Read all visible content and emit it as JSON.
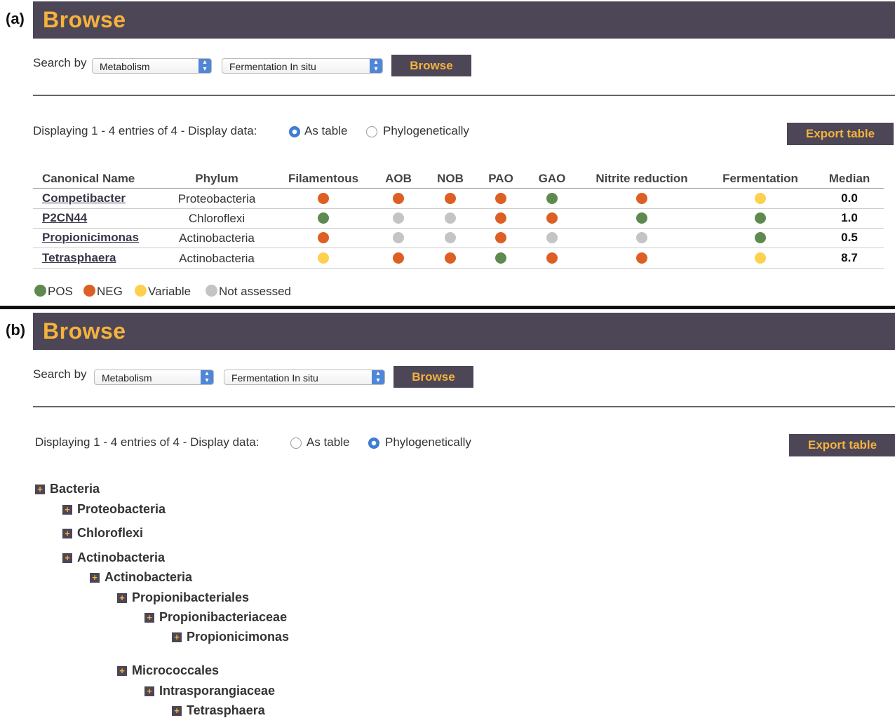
{
  "panel_a": {
    "label": "(a)",
    "title": "Browse",
    "search_by": "Search by",
    "select1": "Metabolism",
    "select2": "Fermentation In situ",
    "browse_button": "Browse",
    "displaying": "Displaying  1 - 4  entries of  4 - Display data:",
    "radio_table": "As table",
    "radio_phylo": "Phylogenetically",
    "selected_mode": "As table",
    "export_button": "Export table",
    "columns": [
      "Canonical Name",
      "Phylum",
      "Filamentous",
      "AOB",
      "NOB",
      "PAO",
      "GAO",
      "Nitrite reduction",
      "Fermentation",
      "Median"
    ],
    "rows": [
      {
        "name": "Competibacter",
        "phylum": "Proteobacteria",
        "traits": [
          "NEG",
          "NEG",
          "NEG",
          "NEG",
          "POS",
          "NEG",
          "Variable"
        ],
        "median": "0.0"
      },
      {
        "name": "P2CN44",
        "phylum": "Chloroflexi",
        "traits": [
          "POS",
          "Not assessed",
          "Not assessed",
          "NEG",
          "NEG",
          "POS",
          "POS"
        ],
        "median": "1.0"
      },
      {
        "name": "Propionicimonas",
        "phylum": "Actinobacteria",
        "traits": [
          "NEG",
          "Not assessed",
          "Not assessed",
          "NEG",
          "Not assessed",
          "Not assessed",
          "POS"
        ],
        "median": "0.5"
      },
      {
        "name": "Tetrasphaera",
        "phylum": "Actinobacteria",
        "traits": [
          "Variable",
          "NEG",
          "NEG",
          "POS",
          "NEG",
          "NEG",
          "Variable"
        ],
        "median": "8.7"
      }
    ],
    "legend": [
      {
        "label": "POS",
        "color": "#5e8a4f"
      },
      {
        "label": "NEG",
        "color": "#dd5f23"
      },
      {
        "label": "Variable",
        "color": "#fdd04d"
      },
      {
        "label": "Not assessed",
        "color": "#c4c4c4"
      }
    ]
  },
  "panel_b": {
    "label": "(b)",
    "title": "Browse",
    "search_by": "Search by",
    "select1": "Metabolism",
    "select2": "Fermentation In situ",
    "browse_button": "Browse",
    "displaying": "Displaying  1 - 4  entries of  4 - Display data:",
    "radio_table": "As table",
    "radio_phylo": "Phylogenetically",
    "selected_mode": "Phylogenetically",
    "export_button": "Export table",
    "tree": [
      {
        "label": "Bacteria",
        "depth": 0
      },
      {
        "label": "Proteobacteria",
        "depth": 1
      },
      {
        "label": "Chloroflexi",
        "depth": 1
      },
      {
        "label": "Actinobacteria",
        "depth": 1
      },
      {
        "label": "Actinobacteria",
        "depth": 2
      },
      {
        "label": "Propionibacteriales",
        "depth": 3
      },
      {
        "label": "Propionibacteriaceae",
        "depth": 4
      },
      {
        "label": "Propionicimonas",
        "depth": 5
      },
      {
        "label": "Micrococcales",
        "depth": 3
      },
      {
        "label": "Intrasporangiaceae",
        "depth": 4
      },
      {
        "label": "Tetrasphaera",
        "depth": 5
      }
    ]
  }
}
